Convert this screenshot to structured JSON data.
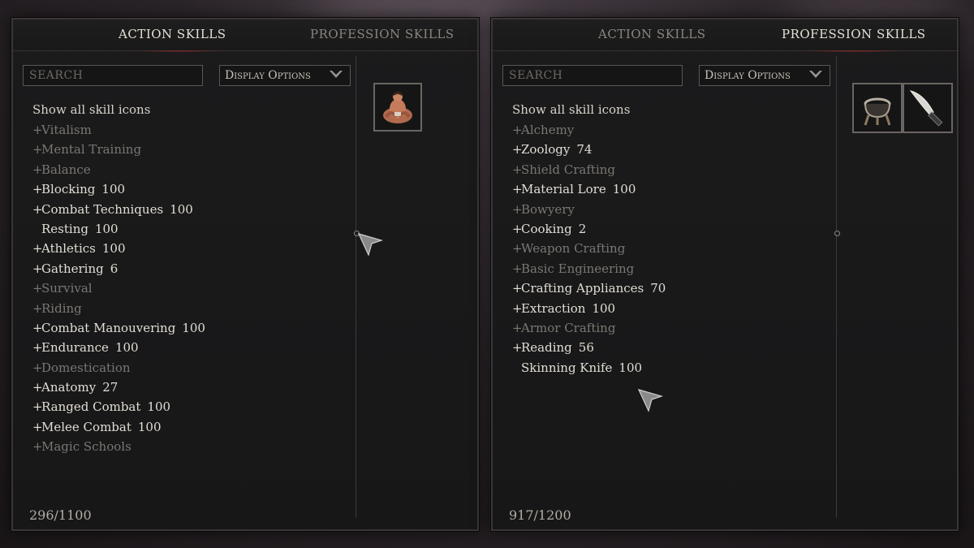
{
  "left_panel": {
    "tabs": [
      {
        "label": "Action Skills",
        "active": true
      },
      {
        "label": "Profession Skills",
        "active": false
      }
    ],
    "search_placeholder": "SEARCH",
    "display_options_label": "Display Options",
    "show_all_label": "Show all skill icons",
    "skills": [
      {
        "plus": "+",
        "name": "Vitalism",
        "value": "",
        "active": false
      },
      {
        "plus": "+",
        "name": "Mental Training",
        "value": "",
        "active": false
      },
      {
        "plus": "+",
        "name": "Balance",
        "value": "",
        "active": false
      },
      {
        "plus": "+",
        "name": "Blocking",
        "value": "100",
        "active": true
      },
      {
        "plus": "+",
        "name": "Combat Techniques",
        "value": "100",
        "active": true
      },
      {
        "plus": "",
        "name": "Resting",
        "value": "100",
        "active": true
      },
      {
        "plus": "+",
        "name": "Athletics",
        "value": "100",
        "active": true
      },
      {
        "plus": "+",
        "name": "Gathering",
        "value": "6",
        "active": true
      },
      {
        "plus": "+",
        "name": "Survival",
        "value": "",
        "active": false
      },
      {
        "plus": "+",
        "name": "Riding",
        "value": "",
        "active": false
      },
      {
        "plus": "+",
        "name": "Combat Manouvering",
        "value": "100",
        "active": true
      },
      {
        "plus": "+",
        "name": "Endurance",
        "value": "100",
        "active": true
      },
      {
        "plus": "+",
        "name": "Domestication",
        "value": "",
        "active": false
      },
      {
        "plus": "+",
        "name": "Anatomy",
        "value": "27",
        "active": true
      },
      {
        "plus": "+",
        "name": "Ranged Combat",
        "value": "100",
        "active": true
      },
      {
        "plus": "+",
        "name": "Melee Combat",
        "value": "100",
        "active": true
      },
      {
        "plus": "+",
        "name": "Magic Schools",
        "value": "",
        "active": false
      }
    ],
    "total": "296/1100",
    "icons": [
      "seated-figure-icon"
    ]
  },
  "right_panel": {
    "tabs": [
      {
        "label": "Action Skills",
        "active": false
      },
      {
        "label": "Profession Skills",
        "active": true
      }
    ],
    "search_placeholder": "SEARCH",
    "display_options_label": "Display Options",
    "show_all_label": "Show all skill icons",
    "skills": [
      {
        "plus": "+",
        "name": "Alchemy",
        "value": "",
        "active": false
      },
      {
        "plus": "+",
        "name": "Zoology",
        "value": "74",
        "active": true
      },
      {
        "plus": "+",
        "name": "Shield Crafting",
        "value": "",
        "active": false
      },
      {
        "plus": "+",
        "name": "Material Lore",
        "value": "100",
        "active": true
      },
      {
        "plus": "+",
        "name": "Bowyery",
        "value": "",
        "active": false
      },
      {
        "plus": "+",
        "name": "Cooking",
        "value": "2",
        "active": true
      },
      {
        "plus": "+",
        "name": "Weapon Crafting",
        "value": "",
        "active": false
      },
      {
        "plus": "+",
        "name": "Basic Engineering",
        "value": "",
        "active": false
      },
      {
        "plus": "+",
        "name": "Crafting Appliances",
        "value": "70",
        "active": true
      },
      {
        "plus": "+",
        "name": "Extraction",
        "value": "100",
        "active": true
      },
      {
        "plus": "+",
        "name": "Armor Crafting",
        "value": "",
        "active": false
      },
      {
        "plus": "+",
        "name": "Reading",
        "value": "56",
        "active": true
      },
      {
        "plus": "",
        "name": "Skinning Knife",
        "value": "100",
        "active": true
      }
    ],
    "total": "917/1200",
    "icons": [
      "cooking-pot-icon",
      "skinning-knife-icon"
    ]
  },
  "colors": {
    "active_text": "#e2ddd4",
    "inactive_text": "#7b7772",
    "tab_accent": "#9a2a2a"
  }
}
